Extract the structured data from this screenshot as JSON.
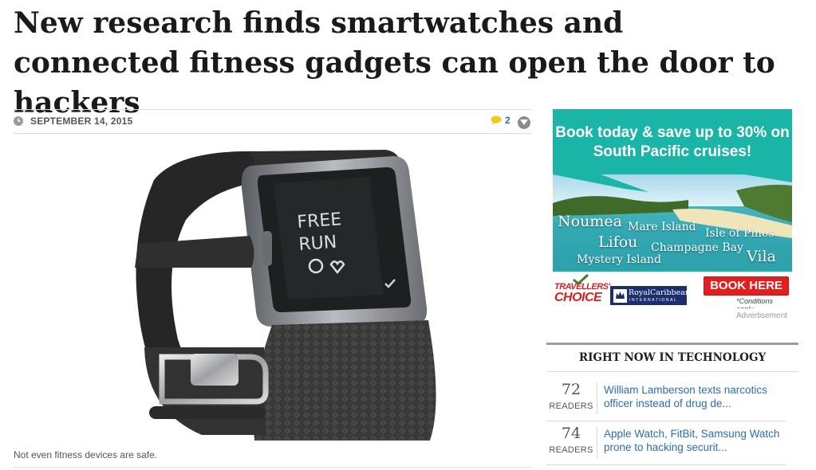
{
  "article": {
    "headline": "New research finds smartwatches and connected fitness gadgets can open the door to hackers",
    "date": "SEPTEMBER 14, 2015",
    "comment_count": "2",
    "caption": "Not even fitness devices are safe."
  },
  "photo": {
    "screen_line1": "FREE",
    "screen_line2": "RUN"
  },
  "ad": {
    "headline": "Book today & save up to 30% on South Pacific cruises!",
    "places": [
      "Noumea",
      "Mare Island",
      "Isle of Pines",
      "Lifou",
      "Champagne Bay",
      "Vila",
      "Mystery Island"
    ],
    "badge_line1": "TRAVELLERS'",
    "badge_line2": "CHOICE",
    "cruise_line_name": "RoyalCaribbean",
    "cruise_line_sub": "INTERNATIONAL",
    "cta": "BOOK HERE",
    "conditions": "*Conditions apply",
    "label": "Advertisement"
  },
  "trending": {
    "title": "RIGHT NOW IN TECHNOLOGY",
    "items": [
      {
        "count": "72",
        "unit": "READERS",
        "title": "William Lamberson texts narcotics officer instead of drug de..."
      },
      {
        "count": "74",
        "unit": "READERS",
        "title": "Apple Watch, FitBit, Samsung Watch prone to hacking securit..."
      }
    ]
  },
  "colors": {
    "link": "#2a6fb0",
    "ad_teal": "#1bb5a7",
    "cta_red": "#e41d1d",
    "comment_bubble": "#f2c81a"
  }
}
